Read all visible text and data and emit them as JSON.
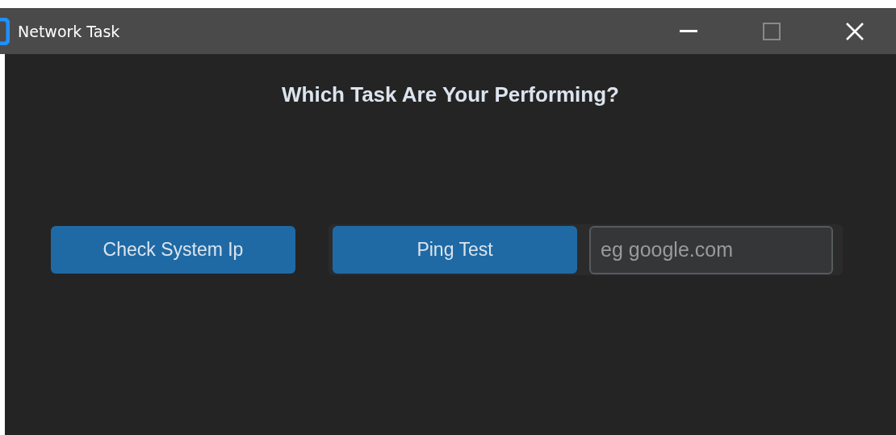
{
  "window": {
    "title": "Network Task",
    "controls": [
      {
        "kind": "minimize",
        "disabled": false
      },
      {
        "kind": "maximize",
        "disabled": true
      },
      {
        "kind": "close",
        "disabled": false
      }
    ]
  },
  "heading": "Which Task Are Your Performing?",
  "actions": {
    "system_ip_button": "Check System Ip",
    "ping_button": "Ping Test",
    "host_field": {
      "placeholder": "eg google.com"
    }
  }
}
